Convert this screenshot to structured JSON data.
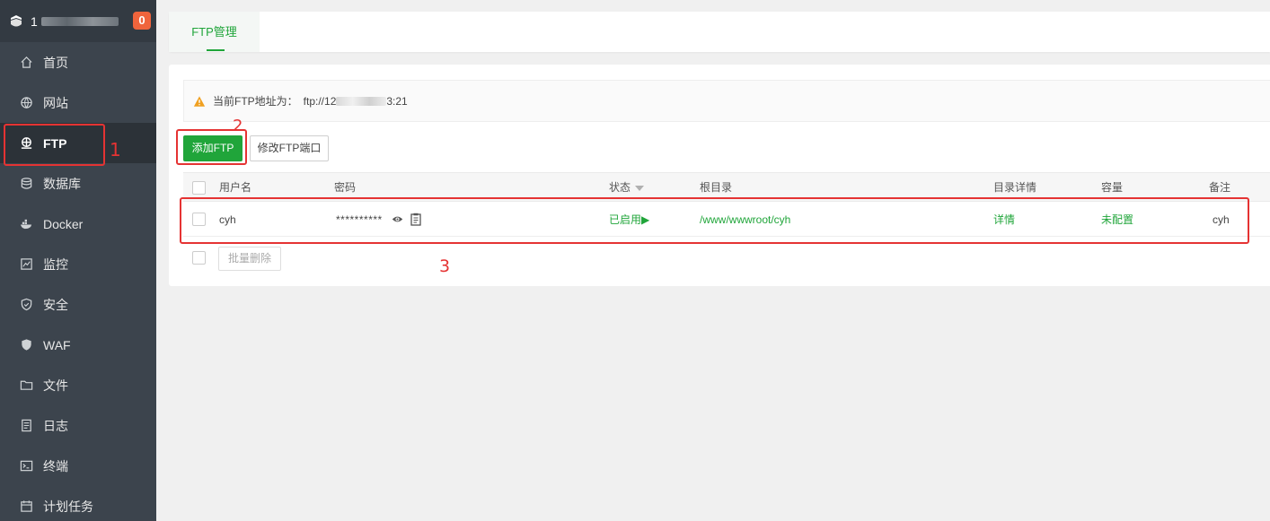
{
  "sidebar": {
    "server_name_prefix": "1",
    "badge": "0",
    "items": [
      {
        "label": "首页",
        "icon": "home-icon"
      },
      {
        "label": "网站",
        "icon": "globe-icon"
      },
      {
        "label": "FTP",
        "icon": "ftp-icon"
      },
      {
        "label": "数据库",
        "icon": "database-icon"
      },
      {
        "label": "Docker",
        "icon": "docker-icon"
      },
      {
        "label": "监控",
        "icon": "monitor-icon"
      },
      {
        "label": "安全",
        "icon": "shield-icon"
      },
      {
        "label": "WAF",
        "icon": "waf-shield-icon"
      },
      {
        "label": "文件",
        "icon": "folder-icon"
      },
      {
        "label": "日志",
        "icon": "log-icon"
      },
      {
        "label": "终端",
        "icon": "terminal-icon"
      },
      {
        "label": "计划任务",
        "icon": "calendar-icon"
      }
    ],
    "active_index": 2
  },
  "tabs": [
    {
      "label": "FTP管理"
    }
  ],
  "notice": {
    "label": "当前FTP地址为：",
    "address_start": "ftp://12",
    "address_end": "3:21"
  },
  "toolbar": {
    "add_label": "添加FTP",
    "port_label": "修改FTP端口"
  },
  "table": {
    "columns": [
      "用户名",
      "密码",
      "状态",
      "根目录",
      "目录详情",
      "容量",
      "备注"
    ],
    "rows": [
      {
        "username": "cyh",
        "password": "**********",
        "status": "已启用▶",
        "root": "/www/wwwroot/cyh",
        "detail": "详情",
        "capacity": "未配置",
        "note": "cyh"
      }
    ]
  },
  "footer": {
    "batch_delete_label": "批量删除"
  },
  "annotations": [
    "1",
    "2",
    "3"
  ],
  "colors": {
    "accent": "#20a53a",
    "sidebar_bg": "#3c444d",
    "badge": "#f0643c",
    "annotation": "#e53333"
  }
}
